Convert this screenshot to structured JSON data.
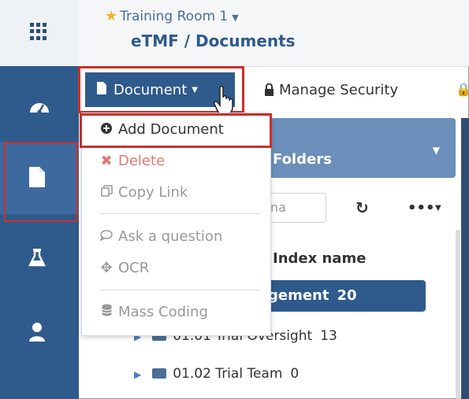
{
  "header": {
    "workspace": "Training Room 1",
    "title": "eTMF / Documents"
  },
  "toolbar": {
    "document_label": "Document",
    "manage_security_label": "Manage Security"
  },
  "document_menu": {
    "items": [
      {
        "label": "Add Document",
        "icon": "plus-circle-icon"
      },
      {
        "label": "Delete",
        "icon": "x-icon"
      },
      {
        "label": "Copy Link",
        "icon": "copy-icon"
      },
      {
        "label": "Ask a question",
        "icon": "speech-bubble-icon"
      },
      {
        "label": "OCR",
        "icon": "ocr-icon"
      },
      {
        "label": "Mass Coding",
        "icon": "database-icon"
      }
    ]
  },
  "folders": {
    "title": "Folders",
    "search_placeholder": "na",
    "column_header": "Index name",
    "rows": [
      {
        "label": "gement",
        "count": "20"
      },
      {
        "label": "01.01 Trial Oversight",
        "count": "13"
      },
      {
        "label": "01.02 Trial Team",
        "count": "0"
      }
    ]
  },
  "colors": {
    "primary": "#2f5a8c",
    "highlight": "#c9302c",
    "star": "#f0b323"
  }
}
